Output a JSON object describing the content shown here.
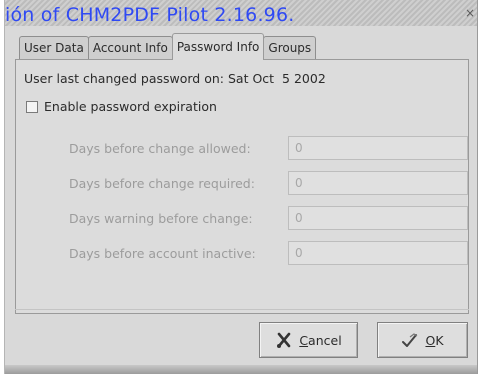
{
  "window": {
    "title": "ión of CHM2PDF Pilot 2.16.96.",
    "close_glyph": "×"
  },
  "tabs": [
    {
      "label": "User Data"
    },
    {
      "label": "Account Info"
    },
    {
      "label": "Password Info",
      "active": true
    },
    {
      "label": "Groups"
    }
  ],
  "password_info": {
    "last_changed_label": "User last changed password on:",
    "last_changed_value": "Sat Oct  5 2002",
    "enable_expiration_label": "Enable password expiration",
    "enable_expiration_checked": false,
    "fields": [
      {
        "label": "Days before change allowed:",
        "value": "0"
      },
      {
        "label": "Days before change required:",
        "value": "0"
      },
      {
        "label": "Days warning before change:",
        "value": "0"
      },
      {
        "label": "Days before account inactive:",
        "value": "0"
      }
    ]
  },
  "buttons": {
    "cancel": {
      "mnemonic": "C",
      "rest": "ancel",
      "icon": "scissors-x-icon"
    },
    "ok": {
      "mnemonic": "O",
      "rest": "K",
      "icon": "hand-check-icon"
    }
  }
}
